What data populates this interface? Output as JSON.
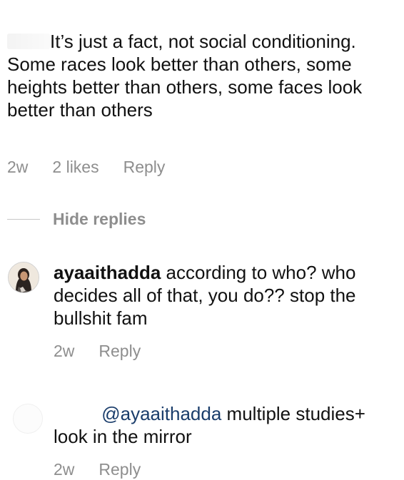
{
  "top_comment": {
    "text": "It’s just a fact, not social conditioning. Some races look better than others, some heights better than others, some faces look better than others",
    "time": "2w",
    "likes": "2 likes",
    "reply_label": "Reply"
  },
  "thread": {
    "hide_replies_label": "Hide replies"
  },
  "replies": [
    {
      "username": "ayaaithadda",
      "text": "according to who? who decides all of that, you do?? stop the bullshit fam",
      "time": "2w",
      "reply_label": "Reply"
    },
    {
      "mention": "@ayaaithadda",
      "text": "multiple studies+ look in the mirror",
      "time": "2w",
      "reply_label": "Reply"
    }
  ],
  "colors": {
    "text": "#111111",
    "meta": "#8e8e8e",
    "mention": "#1a3d6b"
  },
  "icons": {
    "avatar": "user-avatar-photo"
  }
}
